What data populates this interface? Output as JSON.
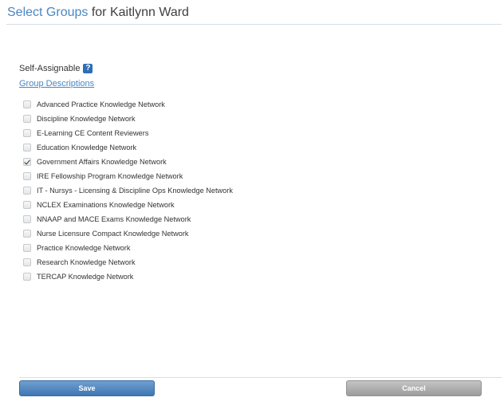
{
  "header": {
    "title_accent": "Select Groups",
    "title_rest": " for Kaitlynn Ward"
  },
  "self_assignable": {
    "label": "Self-Assignable",
    "help_icon": "?"
  },
  "group_descriptions_link": "Group Descriptions",
  "groups": [
    {
      "label": "Advanced Practice Knowledge Network",
      "checked": false
    },
    {
      "label": "Discipline Knowledge Network",
      "checked": false
    },
    {
      "label": "E-Learning CE Content Reviewers",
      "checked": false
    },
    {
      "label": "Education Knowledge Network",
      "checked": false
    },
    {
      "label": "Government Affairs Knowledge Network",
      "checked": true
    },
    {
      "label": "IRE Fellowship Program Knowledge Network",
      "checked": false
    },
    {
      "label": "IT - Nursys - Licensing & Discipline Ops Knowledge Network",
      "checked": false
    },
    {
      "label": "NCLEX Examinations Knowledge Network",
      "checked": false
    },
    {
      "label": "NNAAP and MACE Exams Knowledge Network",
      "checked": false
    },
    {
      "label": "Nurse Licensure Compact Knowledge Network",
      "checked": false
    },
    {
      "label": "Practice Knowledge Network",
      "checked": false
    },
    {
      "label": "Research Knowledge Network",
      "checked": false
    },
    {
      "label": "TERCAP Knowledge Network",
      "checked": false
    }
  ],
  "footer": {
    "save_label": "Save",
    "cancel_label": "Cancel"
  },
  "colors": {
    "accent": "#4a87c2",
    "save_button": "#4f86bf",
    "cancel_button": "#b0b0b0"
  }
}
